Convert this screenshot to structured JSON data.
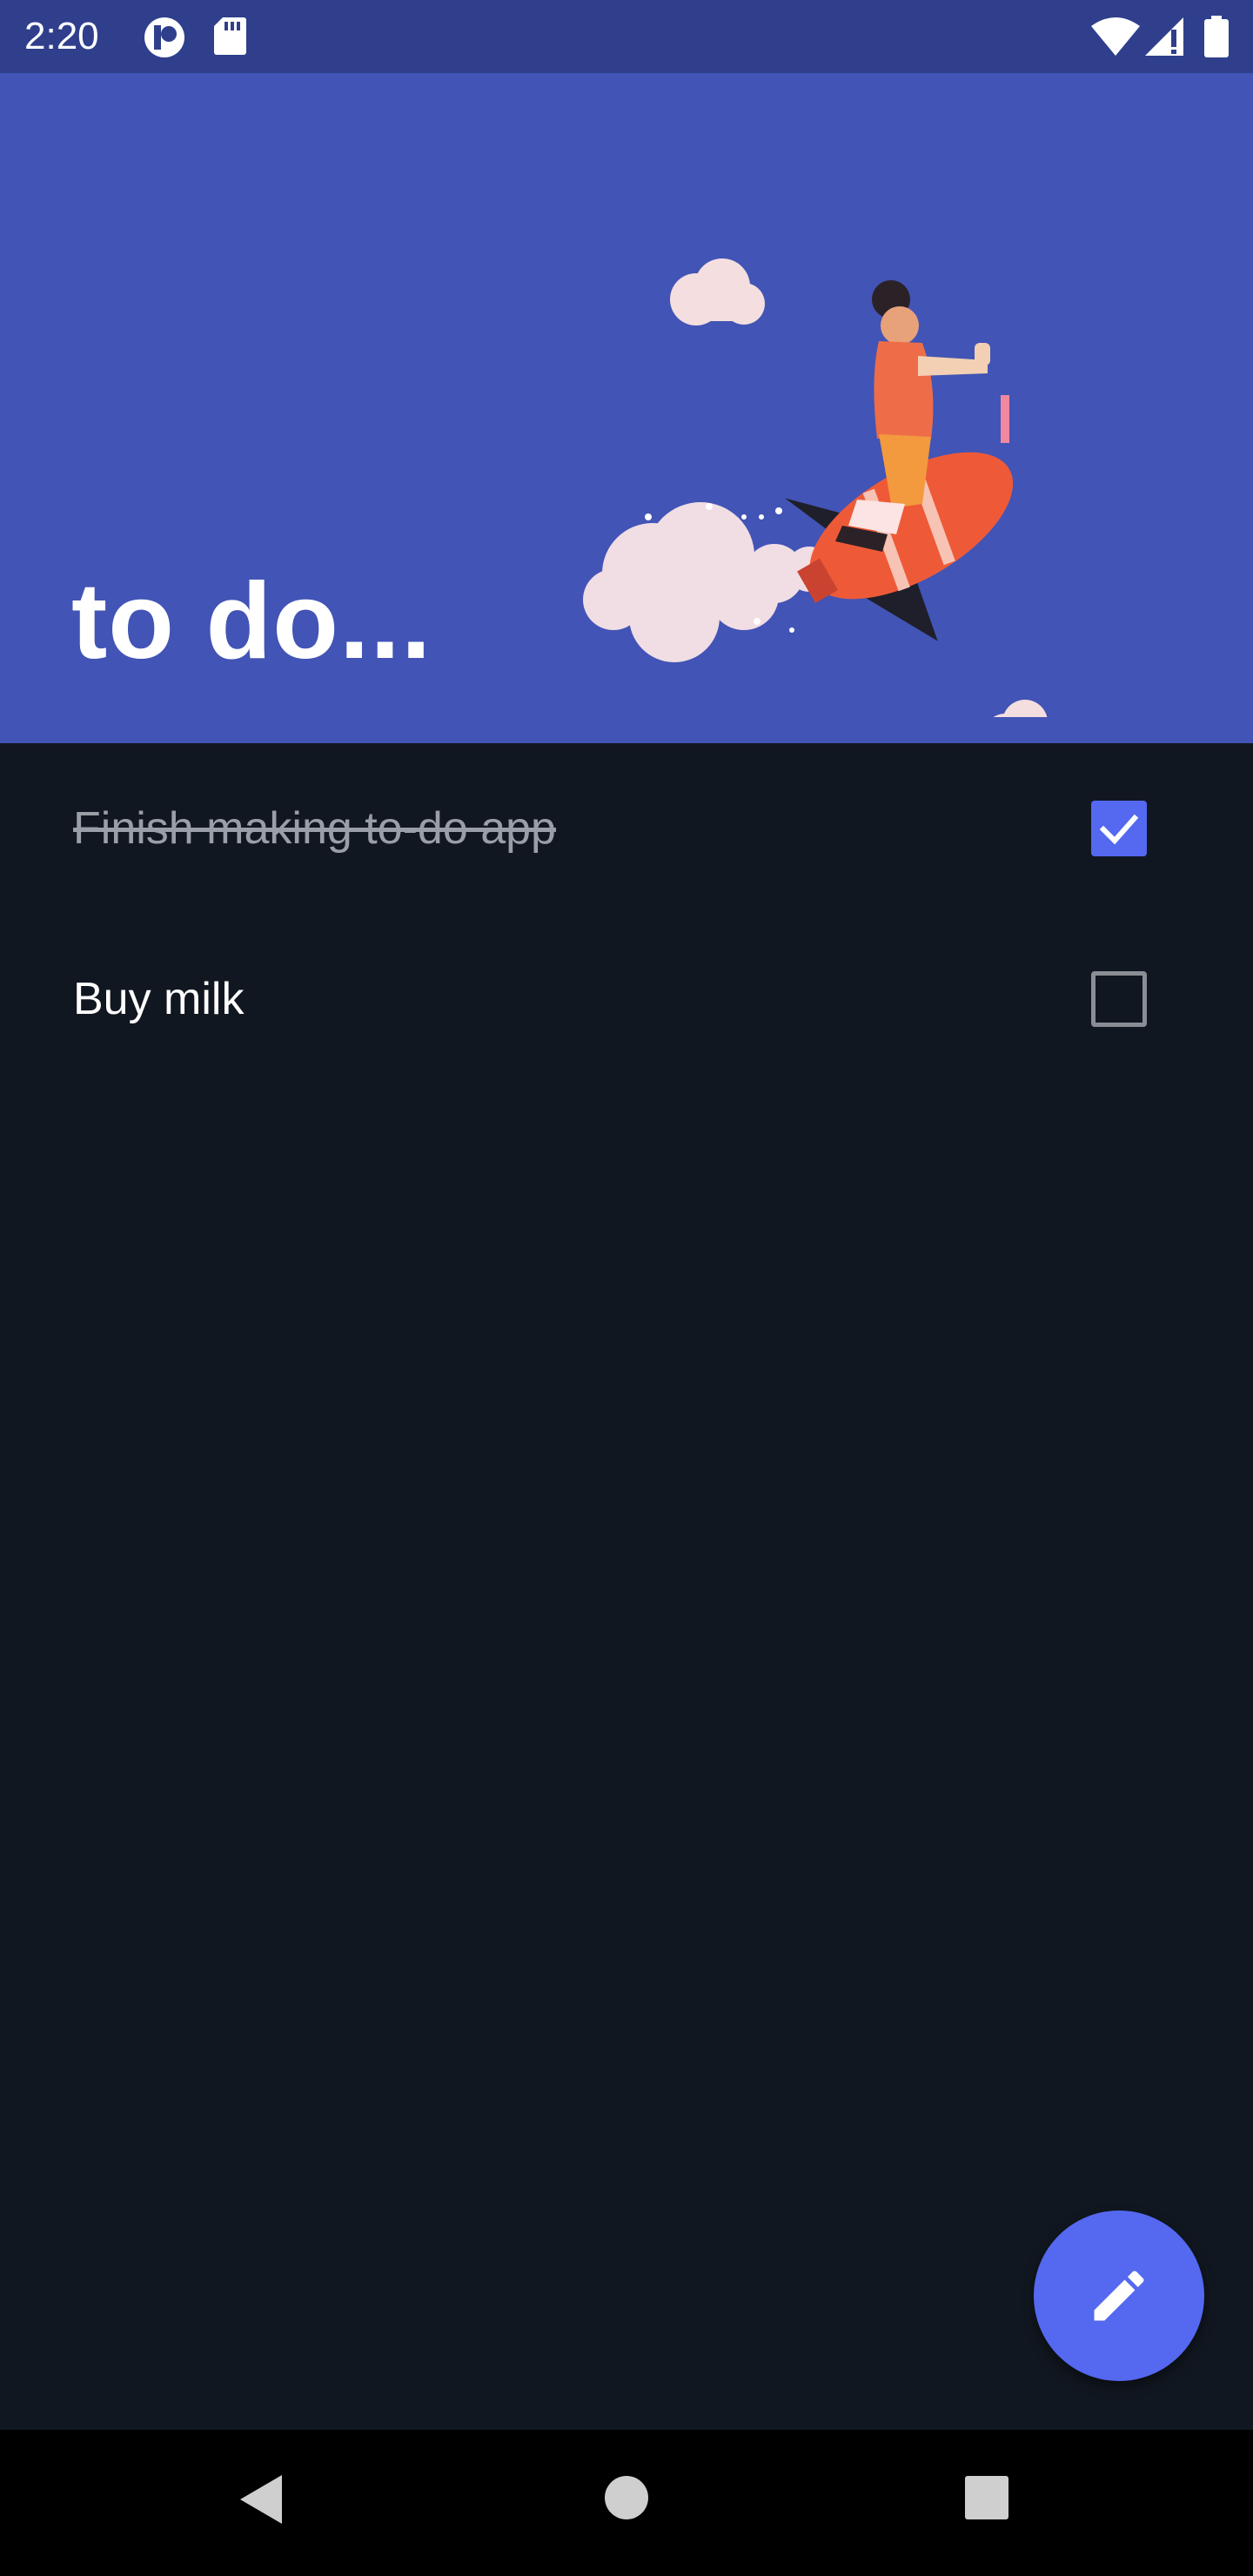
{
  "status_bar": {
    "time": "2:20",
    "icons": [
      "notification-app-icon",
      "sd-card-icon",
      "wifi-icon",
      "cellular-signal-icon",
      "battery-icon"
    ]
  },
  "header": {
    "title": "to do...",
    "illustration": "rocket-rider-illustration"
  },
  "todos": [
    {
      "text": "Finish making to-do app",
      "checked": true
    },
    {
      "text": "Buy milk",
      "checked": false
    }
  ],
  "fab": {
    "icon": "pencil-icon"
  },
  "nav_bar": {
    "icons": [
      "back-icon",
      "home-icon",
      "recents-icon"
    ]
  },
  "colors": {
    "status_bar": "#2f3f8c",
    "header": "#4254b5",
    "background": "#111720",
    "accent": "#5468f0",
    "nav_bar": "#000000"
  }
}
